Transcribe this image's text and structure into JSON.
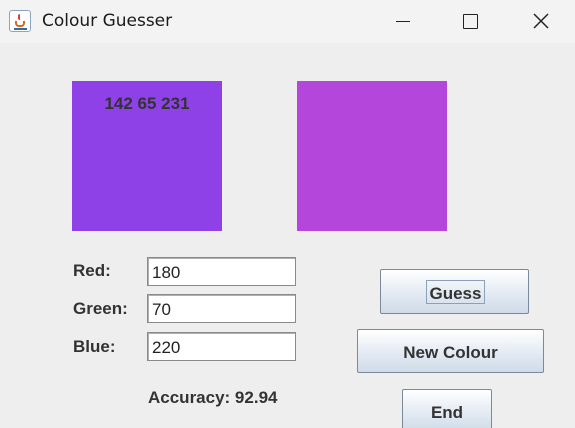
{
  "window": {
    "title": "Colour Guesser",
    "icon": "java-cup-icon"
  },
  "target": {
    "rgb_text": "142 65 231",
    "color": "#8e41e7"
  },
  "guess": {
    "color": "#b446db"
  },
  "fields": {
    "red_label": "Red:",
    "red_value": "180",
    "green_label": "Green:",
    "green_value": "70",
    "blue_label": "Blue:",
    "blue_value": "220"
  },
  "buttons": {
    "guess": "Guess",
    "new_colour": "New Colour",
    "end": "End"
  },
  "accuracy_text": "Accuracy: 92.94"
}
